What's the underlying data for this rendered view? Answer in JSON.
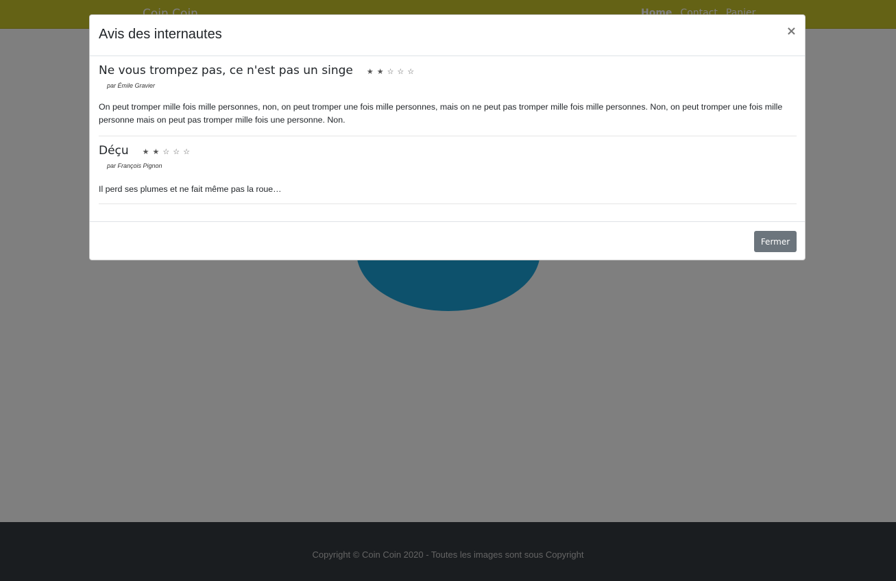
{
  "navbar": {
    "brand": "Coin Coin",
    "links": [
      "Home",
      "Contact",
      "Panier"
    ]
  },
  "footer": {
    "text": "Copyright © Coin Coin 2020 - Toutes les images sont sous Copyright"
  },
  "modal": {
    "title": "Avis des internautes",
    "close_label": "×",
    "fermer_label": "Fermer",
    "reviews": [
      {
        "title": "Ne vous trompez pas, ce n'est pas un singe",
        "rating": 2,
        "max_rating": 5,
        "stars": "★★☆☆☆",
        "author": "par Émile Gravier",
        "text": "On peut tromper mille fois mille personnes, non, on peut tromper une fois mille personnes, mais on ne peut pas tromper mille fois mille personnes. Non, on peut tromper une fois mille personne mais on peut pas tromper mille fois une personne. Non."
      },
      {
        "title": "Déçu",
        "rating": 2,
        "max_rating": 5,
        "stars": "★★☆☆☆",
        "author": "par François Pignon",
        "text": "Il perd ses plumes et ne fait même pas la roue…"
      }
    ]
  },
  "colors": {
    "navbar": "#c9c42b",
    "footer": "#343a40",
    "button": "#6c757d",
    "duck": "#1aa3d8"
  }
}
